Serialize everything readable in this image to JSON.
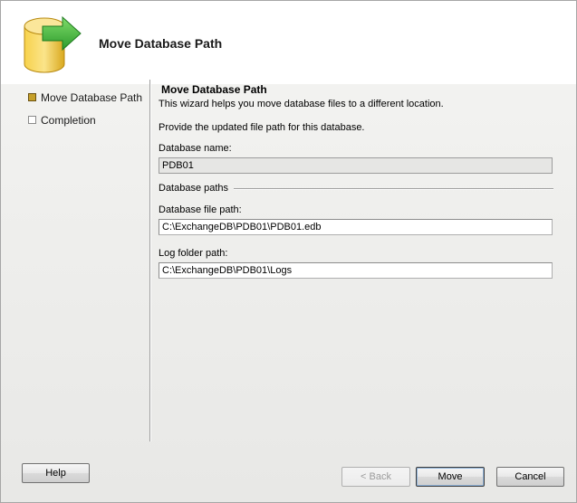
{
  "header": {
    "title": "Move Database Path",
    "icon": "database-move-icon"
  },
  "nav": {
    "items": [
      {
        "label": "Move Database Path",
        "state": "active"
      },
      {
        "label": "Completion",
        "state": "inactive"
      }
    ]
  },
  "main": {
    "section_title": "Move Database Path",
    "description": "This wizard helps you move database files to a different location.",
    "prompt": "Provide the updated file path for this database.",
    "database_name": {
      "label": "Database name:",
      "value": "PDB01"
    },
    "group_label": "Database paths",
    "database_file_path": {
      "label": "Database file path:",
      "value": "C:\\ExchangeDB\\PDB01\\PDB01.edb"
    },
    "log_folder_path": {
      "label": "Log folder path:",
      "value": "C:\\ExchangeDB\\PDB01\\Logs"
    }
  },
  "buttons": {
    "help": "Help",
    "back": "< Back",
    "move": "Move",
    "cancel": "Cancel"
  },
  "colors": {
    "nav_active": "#c6a02a",
    "icon_cylinder": "#f2c53a",
    "icon_arrow": "#3cae3c"
  }
}
